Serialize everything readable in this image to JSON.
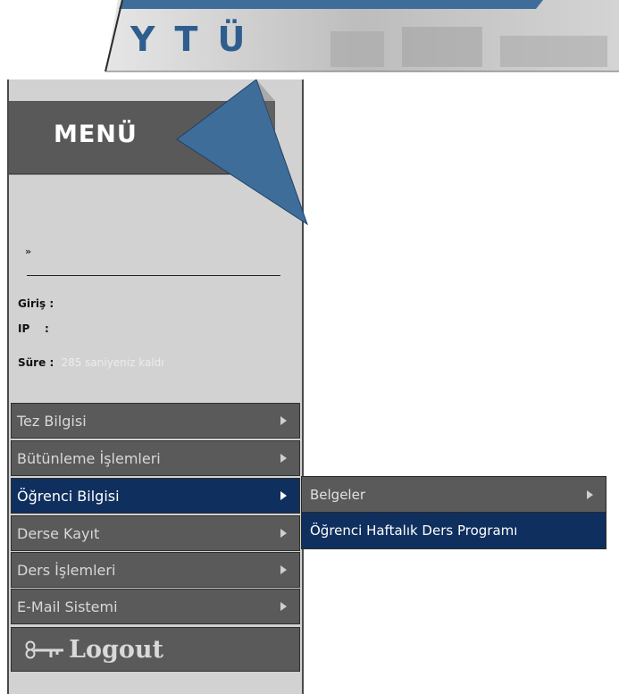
{
  "header": {
    "logo_text": "YTÜ"
  },
  "menu": {
    "title": "MENÜ",
    "breadcrumb_marker": "»",
    "info": {
      "login_label": "Giriş",
      "ip_label": "IP",
      "time_label": "Süre",
      "separator": ":",
      "time_remaining": "285 saniyeniz kaldı"
    },
    "items": [
      {
        "label": "Tez Bilgisi"
      },
      {
        "label": "Bütünleme İşlemleri"
      },
      {
        "label": "Öğrenci Bilgisi"
      },
      {
        "label": "Derse Kayıt"
      },
      {
        "label": "Ders İşlemleri"
      },
      {
        "label": "E-Mail Sistemi"
      }
    ],
    "logout_label": "Logout"
  },
  "submenu": {
    "items": [
      {
        "label": "Belgeler"
      },
      {
        "label": "Öğrenci Haftalık Ders Programı"
      }
    ]
  },
  "colors": {
    "accent_blue": "#3f6d9a",
    "active_navy": "#0f2f5e",
    "menu_gray": "#5a5a5a",
    "panel_gray": "#d2d2d2"
  }
}
